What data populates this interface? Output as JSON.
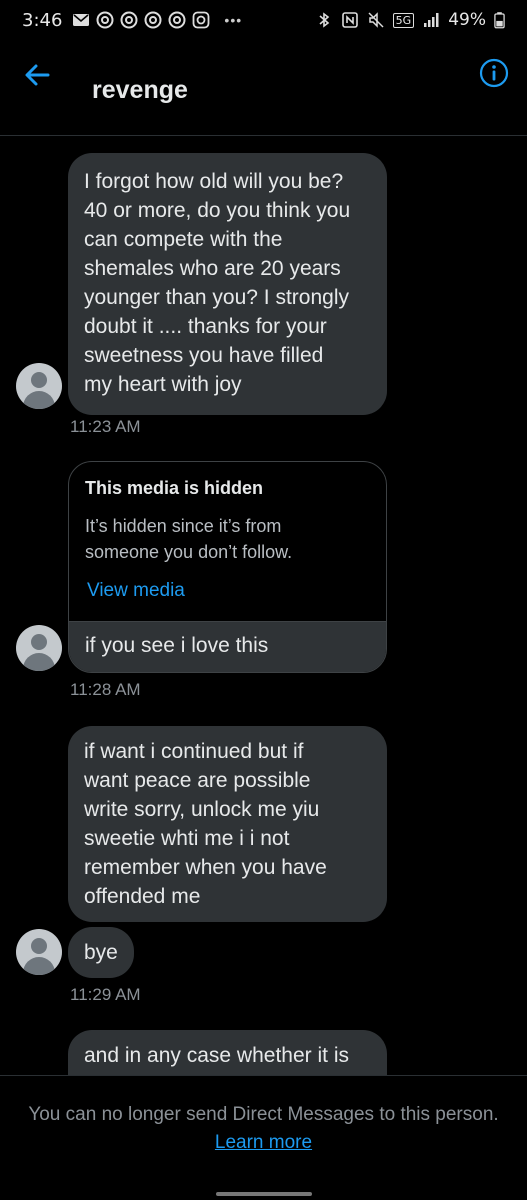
{
  "status_bar": {
    "time": "3:46",
    "battery": "49%",
    "network": "5G"
  },
  "header": {
    "title": "revenge"
  },
  "messages": [
    {
      "lines": [
        "I forgot how old will you be?",
        "40 or more, do you think you",
        "can compete with the",
        "shemales who are 20 years",
        "younger than you? I strongly",
        "doubt it .... thanks for your",
        "sweetness you have filled",
        "my heart with joy"
      ],
      "timestamp": "11:23 AM"
    },
    {
      "media": {
        "title": "This media is hidden",
        "description_line1": "It’s hidden since it’s from",
        "description_line2": "someone you don’t follow.",
        "link": "View media",
        "caption": "if you see  i love this"
      },
      "timestamp": "11:28 AM"
    },
    {
      "lines": [
        "if want i continued but if",
        "want peace are possible",
        "write sorry, unlock me yiu",
        "sweetie whti me i i not",
        "remember when you have",
        "offended me"
      ]
    },
    {
      "lines": [
        "bye"
      ],
      "timestamp": "11:29 AM"
    },
    {
      "lines": [
        "and in any case whether it is"
      ]
    }
  ],
  "footer": {
    "notice": "You can no longer send Direct Messages to this person.",
    "link": "Learn more"
  },
  "colors": {
    "background": "#000000",
    "bubble": "#2f3336",
    "accent": "#1d9bf0",
    "muted": "#8b9197"
  }
}
